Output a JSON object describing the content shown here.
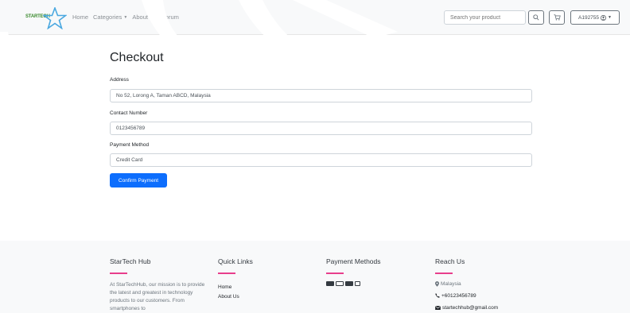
{
  "navbar": {
    "logo_text": "STARTECH",
    "links": [
      "Home",
      "Categories",
      "About Us",
      "Forum"
    ],
    "search_placeholder": "Search your product",
    "user_label": "A192755"
  },
  "page": {
    "title": "Checkout"
  },
  "form": {
    "address_label": "Address",
    "address_value": "No 52, Lorong A, Taman ABCD, Malaysia",
    "contact_label": "Contact Number",
    "contact_value": "0123456789",
    "payment_label": "Payment Method",
    "payment_value": "Credit Card",
    "confirm_label": "Confirm Payment"
  },
  "footer": {
    "about_title": "StarTech Hub",
    "about_text": "At StarTechHub, our mission is to provide the latest and greatest in technology products to our customers. From smartphones to",
    "links_title": "Quick Links",
    "links": [
      "Home",
      "About Us"
    ],
    "payment_title": "Payment Methods",
    "payment_icons": [
      "visa-icon",
      "mastercard-icon",
      "amex-icon",
      "card-icon"
    ],
    "reach_title": "Reach Us",
    "location": "Malaysia",
    "phone": "+60123456789",
    "email": "startechhub@gmail.com"
  },
  "colors": {
    "primary": "#0d6efd",
    "accent_line": "#e83e8c",
    "navbar_bg": "#f8f9fa",
    "footer_bg": "#f8f9fa"
  }
}
